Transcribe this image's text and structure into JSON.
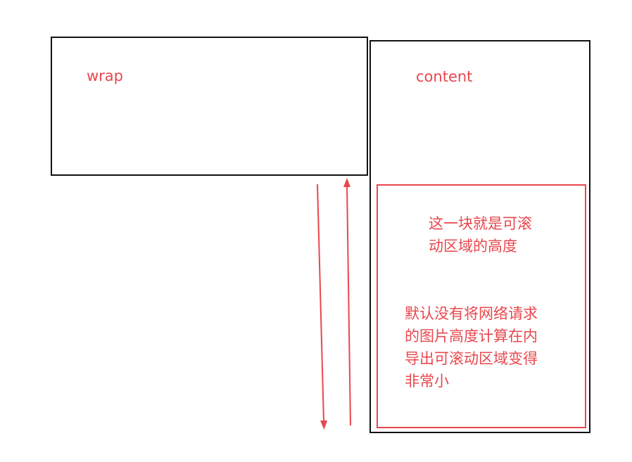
{
  "labels": {
    "wrap": "wrap",
    "content": "content"
  },
  "annotations": {
    "scroll_area": "这一块就是可滚\n动区域的高度",
    "explanation": "默认没有将网络请求\n的图片高度计算在内\n导出可滚动区域变得\n非常小"
  },
  "colors": {
    "accent": "#e8474d",
    "outline": "#111111"
  },
  "icons": {
    "down_arrow": "arrow-down-icon",
    "up_arrow": "arrow-up-icon"
  }
}
